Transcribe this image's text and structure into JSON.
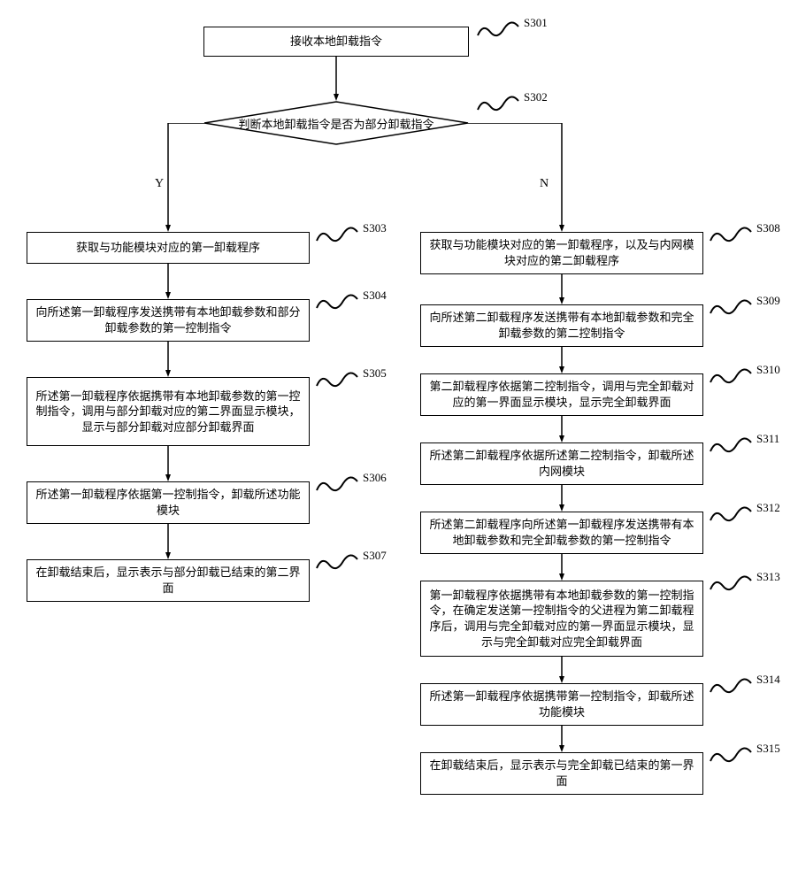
{
  "labels": {
    "s301": "S301",
    "s302": "S302",
    "s303": "S303",
    "s304": "S304",
    "s305": "S305",
    "s306": "S306",
    "s307": "S307",
    "s308": "S308",
    "s309": "S309",
    "s310": "S310",
    "s311": "S311",
    "s312": "S312",
    "s313": "S313",
    "s314": "S314",
    "s315": "S315"
  },
  "branches": {
    "yes": "Y",
    "no": "N"
  },
  "steps": {
    "s301": "接收本地卸载指令",
    "s302": "判断本地卸载指令是否为部分卸载指令",
    "s303": "获取与功能模块对应的第一卸载程序",
    "s304": "向所述第一卸载程序发送携带有本地卸载参数和部分卸载参数的第一控制指令",
    "s305": "所述第一卸载程序依据携带有本地卸载参数的第一控制指令，调用与部分卸载对应的第二界面显示模块，显示与部分卸载对应部分卸载界面",
    "s306": "所述第一卸载程序依据第一控制指令，卸载所述功能模块",
    "s307": "在卸载结束后，显示表示与部分卸载已结束的第二界面",
    "s308": "获取与功能模块对应的第一卸载程序，以及与内网模块对应的第二卸载程序",
    "s309": "向所述第二卸载程序发送携带有本地卸载参数和完全卸载参数的第二控制指令",
    "s310": "第二卸载程序依据第二控制指令，调用与完全卸载对应的第一界面显示模块，显示完全卸载界面",
    "s311": "所述第二卸载程序依据所述第二控制指令，卸载所述内网模块",
    "s312": "所述第二卸载程序向所述第一卸载程序发送携带有本地卸载参数和完全卸载参数的第一控制指令",
    "s313": "第一卸载程序依据携带有本地卸载参数的第一控制指令，在确定发送第一控制指令的父进程为第二卸载程序后，调用与完全卸载对应的第一界面显示模块，显示与完全卸载对应完全卸载界面",
    "s314": "所述第一卸载程序依据携带第一控制指令，卸载所述功能模块",
    "s315": "在卸载结束后，显示表示与完全卸载已结束的第一界面"
  }
}
